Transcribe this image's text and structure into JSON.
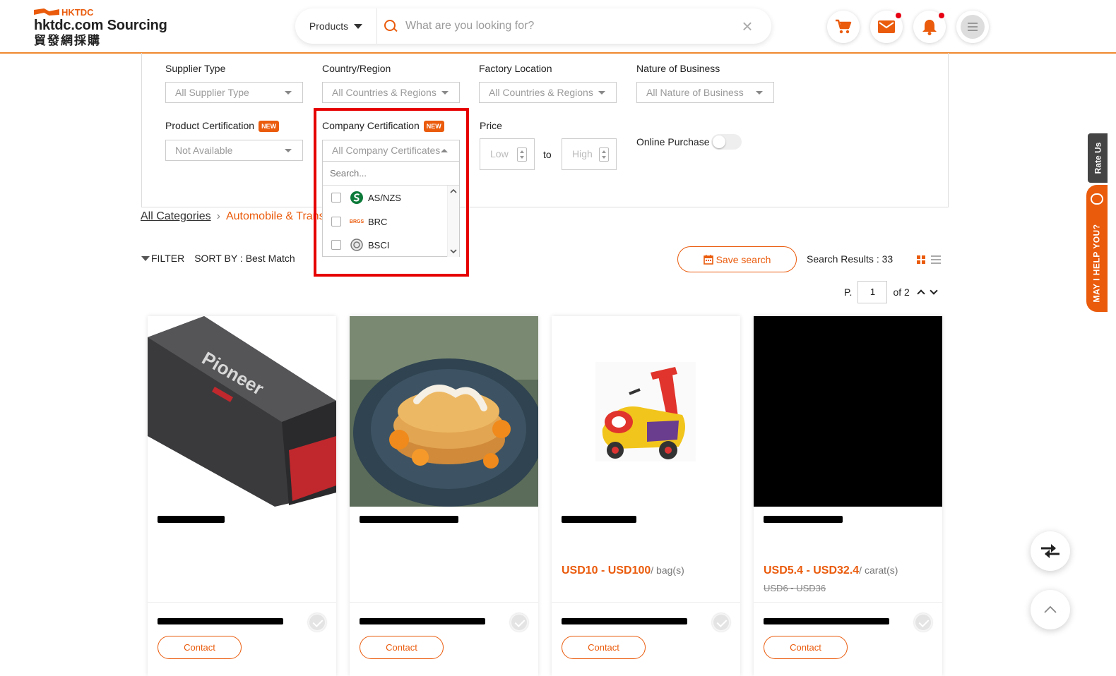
{
  "header": {
    "logo_top": "HKTDC",
    "logo_main": "hktdc.com Sourcing",
    "logo_cn": "貿發網採購",
    "search_category": "Products",
    "search_placeholder": "What are you looking for?",
    "clear_icon": "×",
    "icons": [
      "cart-icon",
      "mail-icon",
      "bell-icon",
      "menu-icon"
    ],
    "accent_color": "#ea5b0c"
  },
  "filters": {
    "supplier_type": {
      "label": "Supplier Type",
      "value": "All Supplier Type"
    },
    "country_region": {
      "label": "Country/Region",
      "value": "All Countries & Regions"
    },
    "factory_location": {
      "label": "Factory Location",
      "value": "All Countries & Regions"
    },
    "nature_business": {
      "label": "Nature of Business",
      "value": "All Nature of Business"
    },
    "product_cert": {
      "label": "Product Certification",
      "badge": "NEW",
      "value": "Not Available"
    },
    "company_cert": {
      "label": "Company Certification",
      "badge": "NEW",
      "value": "All Company Certificates",
      "search_placeholder": "Search...",
      "options": [
        {
          "label": "AS/NZS",
          "logo": "S"
        },
        {
          "label": "BRC",
          "logo": "BRGS"
        },
        {
          "label": "BSCI",
          "logo": ""
        }
      ]
    },
    "price": {
      "label": "Price",
      "low": "Low",
      "to": "to",
      "high": "High"
    },
    "online_purchase": {
      "label": "Online Purchase"
    }
  },
  "breadcrumb": {
    "root": "All Categories",
    "sep": "›",
    "current": "Automobile & Trans"
  },
  "toolbar": {
    "filter": "FILTER",
    "sort_label": "SORT BY :",
    "sort_value": "Best Match",
    "save_search": "Save search",
    "results": "Search Results : 33",
    "page_prefix": "P.",
    "page_current": "1",
    "page_total": "of 2"
  },
  "cards": [
    {
      "price": "",
      "unit": "",
      "old_price": "",
      "contact": "Contact"
    },
    {
      "price": "",
      "unit": "",
      "old_price": "",
      "contact": "Contact"
    },
    {
      "price": "USD10 - USD100",
      "unit": "/ bag(s)",
      "old_price": "",
      "contact": "Contact"
    },
    {
      "price": "USD5.4 - USD32.4",
      "unit": "/ carat(s)",
      "old_price": "USD6 - USD36",
      "contact": "Contact"
    }
  ],
  "side": {
    "rate_us": "Rate Us",
    "help": "MAY I HELP YOU?"
  }
}
